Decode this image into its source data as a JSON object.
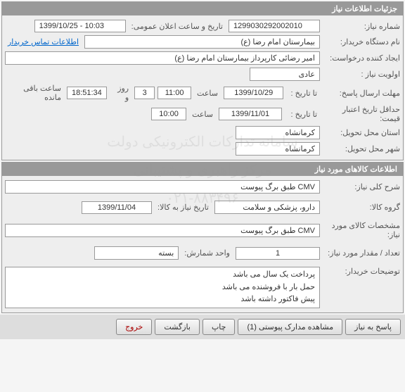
{
  "watermark": {
    "line1": "سامانه تدارکات الکترونیکی دولت",
    "line2": "مرکز راهبری و پشتیبانی",
    "line3": "۰۲۱-۸۸۳۴۹۶"
  },
  "section1": {
    "title": "جزئیات اطلاعات نیاز",
    "need_number_label": "شماره نیاز:",
    "need_number": "1299030292002010",
    "public_announce_label": "تاریخ و ساعت اعلان عمومی:",
    "public_announce": "1399/10/25 - 10:03",
    "buyer_org_label": "نام دستگاه خریدار:",
    "buyer_org": "بیمارستان امام رضا (ع)",
    "contact_link": "اطلاعات تماس خریدار",
    "requester_label": "ایجاد کننده درخواست:",
    "requester": "امیر رضائی کارپرداز بیمارستان امام رضا (ع)",
    "priority_label": "اولویت نیاز :",
    "priority": "عادی",
    "deadline_label": "مهلت ارسال پاسخ:",
    "until_label": "تا تاریخ :",
    "deadline_date": "1399/10/29",
    "time_label": "ساعت",
    "deadline_time": "11:00",
    "remaining_time": "18:51:34",
    "days": "3",
    "days_label": "روز و",
    "remaining_label": "ساعت باقی مانده",
    "validity_label": "حداقل تاریخ اعتبار قیمت:",
    "validity_date": "1399/11/01",
    "validity_time": "10:00",
    "province_label": "استان محل تحویل:",
    "province": "کرمانشاه",
    "city_label": "شهر محل تحویل:",
    "city": "کرمانشاه"
  },
  "section2": {
    "title": "اطلاعات کالاهای مورد نیاز",
    "general_desc_label": "شرح کلی نیاز:",
    "general_desc": "CMV طبق برگ پیوست",
    "group_label": "گروه کالا:",
    "group": "دارو، پزشکی و سلامت",
    "need_until_label": "تاریخ نیاز به کالا:",
    "need_until": "1399/11/04",
    "spec_label": "مشخصات کالای مورد نیاز:",
    "spec": "CMV طبق برگ پیوست",
    "qty_label": "تعداد / مقدار مورد نیاز:",
    "qty": "1",
    "unit_label": "واحد شمارش:",
    "unit": "بسته",
    "notes_label": "توضیحات خریدار:",
    "notes_line1": "پرداخت یک سال می باشد",
    "notes_line2": "حمل بار با فروشنده می باشد",
    "notes_line3": "پیش فاکتور داشته باشد"
  },
  "footer": {
    "respond": "پاسخ به نیاز",
    "view_attach": "مشاهده مدارک پیوستی (1)",
    "print": "چاپ",
    "back": "بازگشت",
    "exit": "خروج"
  }
}
